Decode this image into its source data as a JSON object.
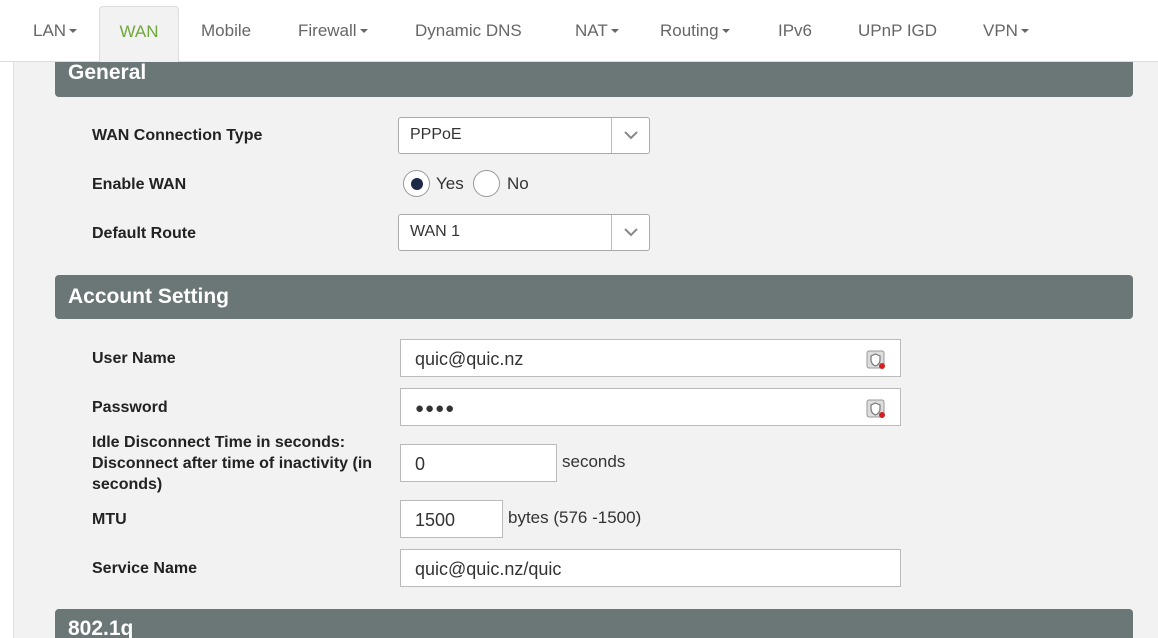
{
  "tabs": [
    {
      "label": "LAN",
      "dropdown": true
    },
    {
      "label": "WAN",
      "dropdown": false,
      "active": true
    },
    {
      "label": "Mobile",
      "dropdown": false
    },
    {
      "label": "Firewall",
      "dropdown": true
    },
    {
      "label": "Dynamic DNS",
      "dropdown": false
    },
    {
      "label": "NAT",
      "dropdown": true
    },
    {
      "label": "Routing",
      "dropdown": true
    },
    {
      "label": "IPv6",
      "dropdown": false
    },
    {
      "label": "UPnP IGD",
      "dropdown": false
    },
    {
      "label": "VPN",
      "dropdown": true
    }
  ],
  "general": {
    "header": "General",
    "wan_connection_type": {
      "label": "WAN Connection Type",
      "value": "PPPoE"
    },
    "enable_wan": {
      "label": "Enable WAN",
      "yes": "Yes",
      "no": "No",
      "selected": "Yes"
    },
    "default_route": {
      "label": "Default Route",
      "value": "WAN 1"
    }
  },
  "account": {
    "header": "Account Setting",
    "user_name": {
      "label": "User Name",
      "value": "quic@quic.nz"
    },
    "password": {
      "label": "Password",
      "value": "●●●●"
    },
    "idle": {
      "label_line1": "Idle Disconnect Time in seconds:",
      "label_line2": "Disconnect after time of inactivity (in",
      "label_line3": "seconds)",
      "value": "0",
      "suffix": "seconds"
    },
    "mtu": {
      "label": "MTU",
      "value": "1500",
      "suffix": "bytes (576 -1500)"
    },
    "service_name": {
      "label": "Service Name",
      "value": "quic@quic.nz/quic"
    }
  },
  "dot1q": {
    "header": "802.1q"
  },
  "colors": {
    "accent": "#6ea83a",
    "header_bg": "#6b7777",
    "panel_bg": "#f2f2f2",
    "radio_fill": "#1c2a48"
  }
}
